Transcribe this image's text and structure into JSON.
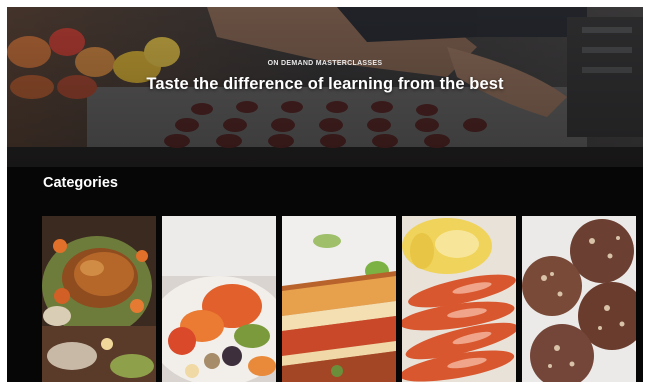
{
  "hero": {
    "kicker": "ON DEMAND MASTERCLASSES",
    "headline": "Taste the difference of learning from the best"
  },
  "categories": {
    "title": "Categories",
    "cards": [
      {
        "name": "roast-chicken"
      },
      {
        "name": "salad"
      },
      {
        "name": "lasagna"
      },
      {
        "name": "langoustines"
      },
      {
        "name": "cookies"
      }
    ]
  },
  "colors": {
    "page_background": "#060606",
    "text_primary": "#ffffff"
  }
}
